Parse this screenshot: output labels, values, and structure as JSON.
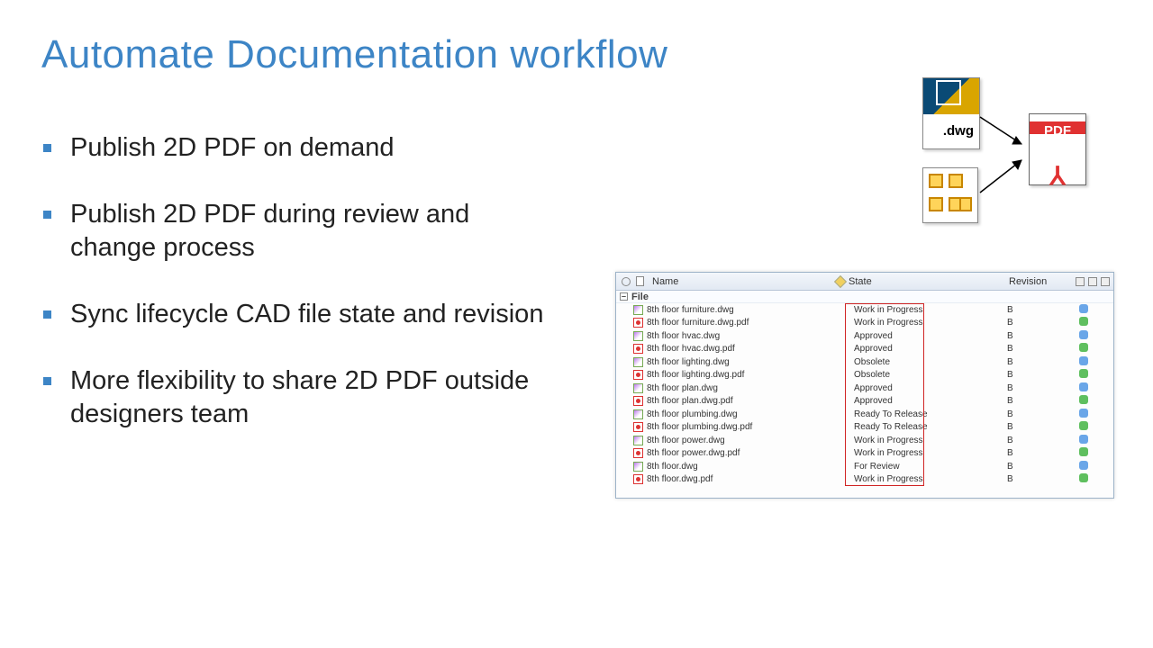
{
  "title": "Automate Documentation workflow",
  "bullets": [
    "Publish 2D PDF on demand",
    "Publish 2D PDF during review and change process",
    "Sync lifecycle CAD file state and revision",
    "More flexibility to share 2D PDF outside designers team"
  ],
  "diagram": {
    "dwg_label": ".dwg",
    "pdf_label": "PDF"
  },
  "panel": {
    "columns": {
      "name": "Name",
      "state": "State",
      "revision": "Revision"
    },
    "category": "File",
    "rows": [
      {
        "type": "dwg",
        "name": "8th floor furniture.dwg",
        "state": "Work in Progress",
        "rev": "B",
        "dot": "blue"
      },
      {
        "type": "pdf",
        "name": "8th floor furniture.dwg.pdf",
        "state": "Work in Progress",
        "rev": "B",
        "dot": "green"
      },
      {
        "type": "dwg",
        "name": "8th floor hvac.dwg",
        "state": "Approved",
        "rev": "B",
        "dot": "blue"
      },
      {
        "type": "pdf",
        "name": "8th floor hvac.dwg.pdf",
        "state": "Approved",
        "rev": "B",
        "dot": "green"
      },
      {
        "type": "dwg",
        "name": "8th floor lighting.dwg",
        "state": "Obsolete",
        "rev": "B",
        "dot": "blue"
      },
      {
        "type": "pdf",
        "name": "8th floor lighting.dwg.pdf",
        "state": "Obsolete",
        "rev": "B",
        "dot": "green"
      },
      {
        "type": "dwg",
        "name": "8th floor plan.dwg",
        "state": "Approved",
        "rev": "B",
        "dot": "blue"
      },
      {
        "type": "pdf",
        "name": "8th floor plan.dwg.pdf",
        "state": "Approved",
        "rev": "B",
        "dot": "green"
      },
      {
        "type": "dwg",
        "name": "8th floor plumbing.dwg",
        "state": "Ready To Release",
        "rev": "B",
        "dot": "blue"
      },
      {
        "type": "pdf",
        "name": "8th floor plumbing.dwg.pdf",
        "state": "Ready To Release",
        "rev": "B",
        "dot": "green"
      },
      {
        "type": "dwg",
        "name": "8th floor power.dwg",
        "state": "Work in Progress",
        "rev": "B",
        "dot": "blue"
      },
      {
        "type": "pdf",
        "name": "8th floor power.dwg.pdf",
        "state": "Work in Progress",
        "rev": "B",
        "dot": "green"
      },
      {
        "type": "dwg",
        "name": "8th floor.dwg",
        "state": "For Review",
        "rev": "B",
        "dot": "blue"
      },
      {
        "type": "pdf",
        "name": "8th floor.dwg.pdf",
        "state": "Work in Progress",
        "rev": "B",
        "dot": "green"
      }
    ]
  }
}
